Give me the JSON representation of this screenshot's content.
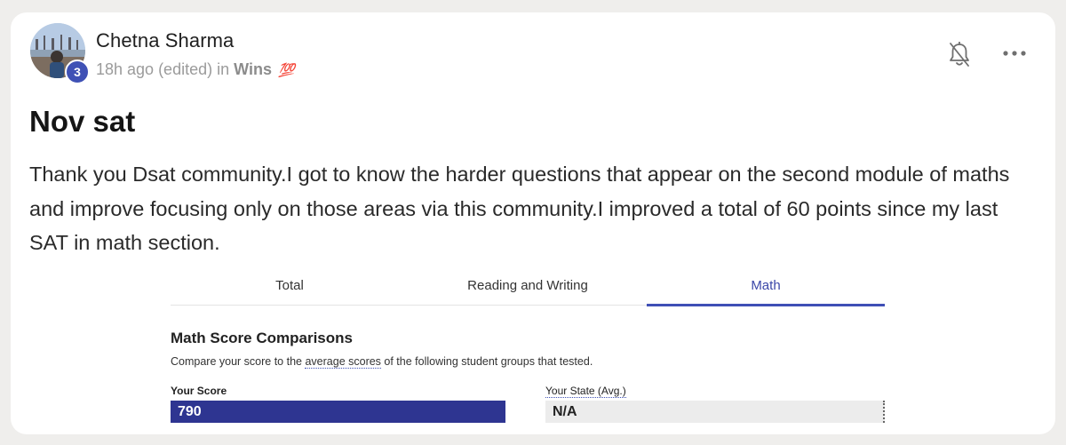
{
  "post": {
    "author": "Chetna Sharma",
    "level": "3",
    "time": "18h ago (edited)",
    "in_word": "in",
    "category": "Wins",
    "category_emoji": "💯",
    "title": "Nov sat",
    "body": "Thank you Dsat community.I got to know the harder questions that appear on the second module of maths and improve focusing only on those areas via this community.I improved a total of 60 points since my last SAT in math section."
  },
  "icons": {
    "notifications": "bell-off-icon",
    "menu": "more-horizontal-icon"
  },
  "score_report": {
    "tabs": [
      {
        "label": "Total",
        "active": false
      },
      {
        "label": "Reading and Writing",
        "active": false
      },
      {
        "label": "Math",
        "active": true
      }
    ],
    "title": "Math Score Comparisons",
    "desc_prefix": "Compare your score to the ",
    "desc_link": "average scores",
    "desc_suffix": " of the following student groups that tested.",
    "your_score_label": "Your Score",
    "your_score_value": "790",
    "state_label": "Your State (Avg.)",
    "state_value": "N/A"
  },
  "colors": {
    "accent": "#3f51b5",
    "score_bar": "#2e3591",
    "page_bg": "#efeeec"
  }
}
